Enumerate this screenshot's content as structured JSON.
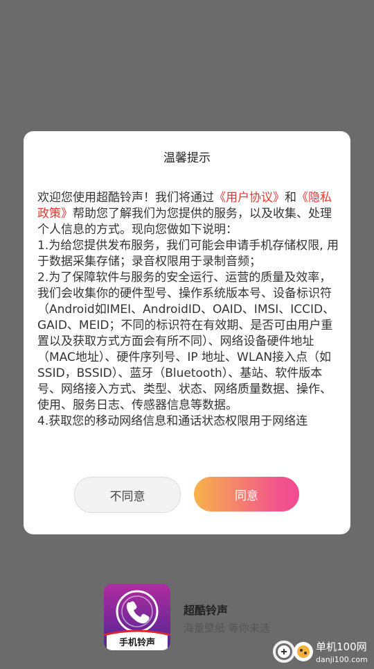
{
  "dialog": {
    "title": "温馨提示",
    "intro_text_1": "欢迎您使用超酷铃声！我们将通过",
    "user_agreement_link": "《用户协议》",
    "intro_text_2": "和",
    "privacy_policy_link": "《隐私政策》",
    "intro_text_3": "帮助您了解我们为您提供的服务，以及收集、处理个人信息的方式。现向您做如下说明：",
    "clause_1": "1.为给您提供发布服务，我们可能会申请手机存储权限, 用于数据采集存储；录音权限用于录制音频；",
    "clause_2": "2.为了保障软件与服务的安全运行、运营的质量及效率，我们会收集你的硬件型号、操作系统版本号、设备标识符（Android如IMEI、AndroidID、OAID、IMSI、ICCID、GAID、MEID；不同的标识符在有效期、是否可由用户重置以及获取方式方面会有所不同）、网络设备硬件地址（MAC地址）、硬件序列号、IP 地址、WLAN接入点（如SSID，BSSID）、蓝牙（Bluetooth）、基站、软件版本号、网络接入方式、类型、状态、网络质量数据、操作、使用、服务日志、传感器信息等数据。",
    "clause_4_partial": "4.获取您的移动网络信息和通话状态权限用于网络连",
    "disagree_label": "不同意",
    "agree_label": "同意"
  },
  "splash": {
    "icon_text": "手机铃声",
    "app_name": "超酷铃声",
    "slogan": "海量壁纸 等你来选"
  },
  "watermark": {
    "name": "单机100网",
    "url": "danji100.com"
  }
}
